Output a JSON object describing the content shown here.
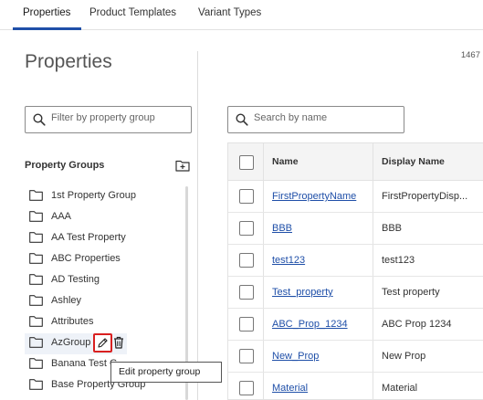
{
  "tabs": [
    {
      "label": "Properties",
      "active": true
    },
    {
      "label": "Product Templates",
      "active": false
    },
    {
      "label": "Variant Types",
      "active": false
    }
  ],
  "page": {
    "title": "Properties",
    "count_text": "1467"
  },
  "sidebar": {
    "filter_placeholder": "Filter by property group",
    "heading": "Property Groups",
    "groups": [
      {
        "label": "1st Property Group"
      },
      {
        "label": "AAA"
      },
      {
        "label": "AA Test Property"
      },
      {
        "label": "ABC Properties"
      },
      {
        "label": "AD Testing"
      },
      {
        "label": "Ashley"
      },
      {
        "label": "Attributes"
      },
      {
        "label": "AzGroup"
      },
      {
        "label": "Banana Test G"
      },
      {
        "label": "Base Property Group"
      }
    ],
    "tooltip": "Edit property group"
  },
  "main": {
    "search_placeholder": "Search by name",
    "columns": [
      "Name",
      "Display Name"
    ],
    "rows": [
      {
        "name": "FirstPropertyName",
        "display": "FirstPropertyDisp..."
      },
      {
        "name": "BBB",
        "display": "BBB"
      },
      {
        "name": "test123",
        "display": "test123"
      },
      {
        "name": "Test_property",
        "display": "Test property"
      },
      {
        "name": "ABC_Prop_1234",
        "display": "ABC Prop 1234"
      },
      {
        "name": "New_Prop",
        "display": "New Prop"
      },
      {
        "name": "Material",
        "display": "Material"
      }
    ]
  },
  "colors": {
    "accent": "#1f4fa8",
    "highlight_border": "#d92020"
  },
  "icons": {
    "search": "search-icon",
    "add_folder": "add-folder-icon",
    "folder": "folder-icon",
    "edit": "pencil-icon",
    "delete": "trash-icon"
  }
}
